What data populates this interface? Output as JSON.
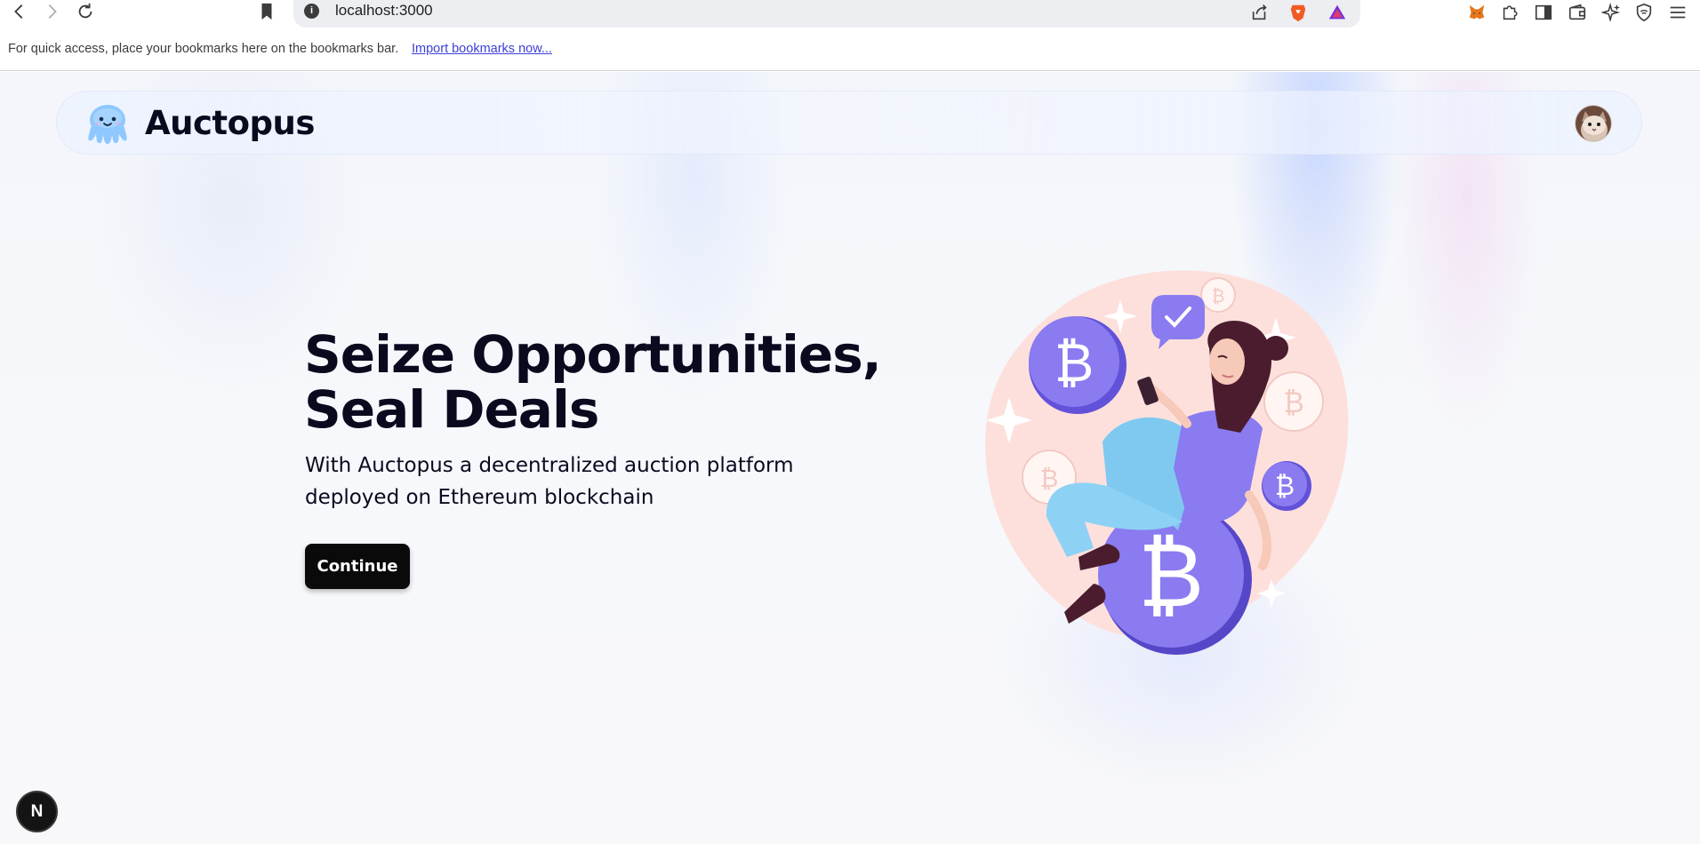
{
  "browser": {
    "url": "localhost:3000",
    "bookmarks_message": "For quick access, place your bookmarks here on the bookmarks bar.",
    "import_link": "Import bookmarks now..."
  },
  "navbar": {
    "brand": "Auctopus"
  },
  "hero": {
    "title_line1": "Seize Opportunities,",
    "title_line2": "Seal Deals",
    "subtitle": "With Auctopus a decentralized auction platform deployed on Ethereum blockchain",
    "cta_label": "Continue"
  },
  "dev_badge": {
    "label": "N"
  },
  "colors": {
    "accent_purple": "#7b6cf0",
    "blob_pink": "#fde0dc",
    "button_bg": "#0a0a0a"
  }
}
